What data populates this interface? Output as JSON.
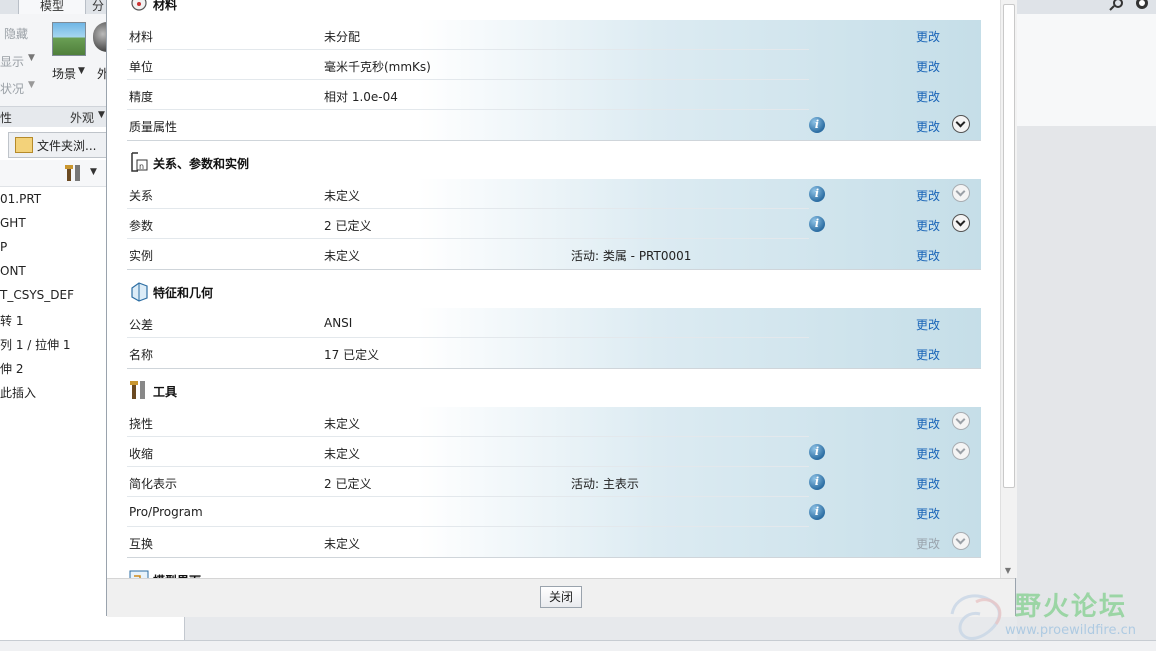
{
  "app": {
    "ribbon": {
      "tab_model": "模型",
      "tab_next": "分",
      "hide": "隐藏",
      "display": "显示",
      "status": "状况",
      "scene": "场景",
      "appearance": "外",
      "group_left": "性",
      "group_appearance": "外观"
    },
    "file_browser_tab": "文件夹浏...",
    "tree_items": [
      "01.PRT",
      "GHT",
      "P",
      "ONT",
      "T_CSYS_DEF",
      "转 1",
      "列 1 / 拉伸 1",
      "伸 2",
      "此插入"
    ]
  },
  "dialog": {
    "close_label": "关闭",
    "sections": [
      {
        "title": "材料",
        "icon": "material-icon",
        "rows": [
          {
            "label": "材料",
            "value": "未分配",
            "extra": "",
            "info": false,
            "change": "更改",
            "change_enabled": true,
            "expand": "none"
          },
          {
            "label": "单位",
            "value": "毫米千克秒(mmKs)",
            "extra": "",
            "info": false,
            "change": "更改",
            "change_enabled": true,
            "expand": "none"
          },
          {
            "label": "精度",
            "value": "相对 1.0e-04",
            "extra": "",
            "info": false,
            "change": "更改",
            "change_enabled": true,
            "expand": "none"
          },
          {
            "label": "质量属性",
            "value": "",
            "extra": "",
            "info": true,
            "change": "更改",
            "change_enabled": true,
            "expand": "dark"
          }
        ]
      },
      {
        "title": "关系、参数和实例",
        "icon": "relations-icon",
        "rows": [
          {
            "label": "关系",
            "value": "未定义",
            "extra": "",
            "info": true,
            "change": "更改",
            "change_enabled": true,
            "expand": "dim"
          },
          {
            "label": "参数",
            "value": "2 已定义",
            "extra": "",
            "info": true,
            "change": "更改",
            "change_enabled": true,
            "expand": "dark"
          },
          {
            "label": "实例",
            "value": "未定义",
            "extra": "活动: 类属 - PRT0001",
            "info": false,
            "change": "更改",
            "change_enabled": true,
            "expand": "none"
          }
        ]
      },
      {
        "title": "特征和几何",
        "icon": "features-icon",
        "rows": [
          {
            "label": "公差",
            "value": "ANSI",
            "extra": "",
            "info": false,
            "change": "更改",
            "change_enabled": true,
            "expand": "none"
          },
          {
            "label": "名称",
            "value": "17 已定义",
            "extra": "",
            "info": false,
            "change": "更改",
            "change_enabled": true,
            "expand": "none"
          }
        ]
      },
      {
        "title": "工具",
        "icon": "tools-icon",
        "rows": [
          {
            "label": "挠性",
            "value": "未定义",
            "extra": "",
            "info": false,
            "change": "更改",
            "change_enabled": true,
            "expand": "dim"
          },
          {
            "label": "收缩",
            "value": "未定义",
            "extra": "",
            "info": true,
            "change": "更改",
            "change_enabled": true,
            "expand": "dim"
          },
          {
            "label": "简化表示",
            "value": "2 已定义",
            "extra": "活动: 主表示",
            "info": true,
            "change": "更改",
            "change_enabled": true,
            "expand": "none"
          },
          {
            "label": "Pro/Program",
            "value": "",
            "extra": "",
            "info": true,
            "change": "更改",
            "change_enabled": true,
            "expand": "none"
          },
          {
            "label": "互换",
            "value": "未定义",
            "extra": "",
            "info": false,
            "change": "更改",
            "change_enabled": false,
            "expand": "dim"
          }
        ]
      },
      {
        "title": "模型界面",
        "icon": "model-interface-icon",
        "rows": []
      }
    ]
  },
  "watermark": {
    "title": "野火论坛",
    "url": "www.proewildfire.cn"
  },
  "colors": {
    "link": "#1a65b8",
    "link_disabled": "#9aa4ad",
    "row_gradient_end": "#c5dee8"
  }
}
